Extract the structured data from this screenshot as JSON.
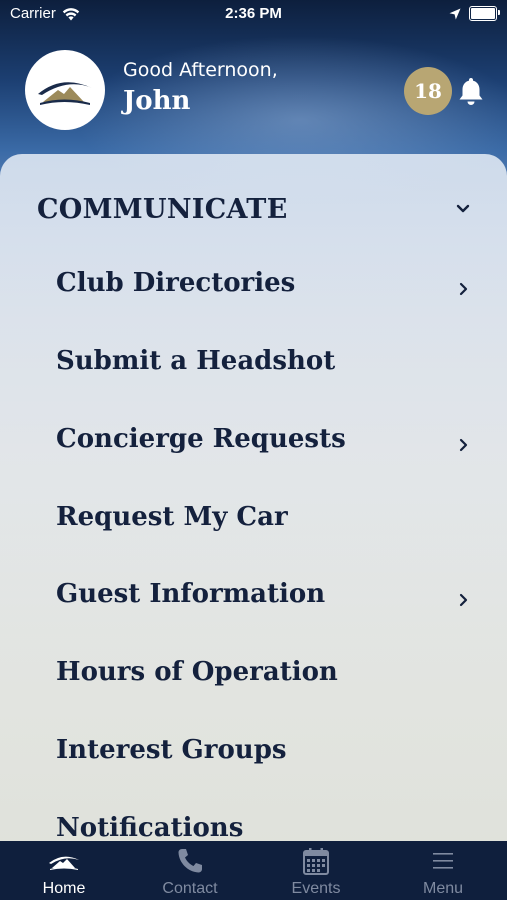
{
  "status_bar": {
    "carrier": "Carrier",
    "time": "2:36 PM"
  },
  "header": {
    "greeting": "Good Afternoon,",
    "user_name": "John",
    "notification_count": "18"
  },
  "menu": {
    "section_title": "COMMUNICATE",
    "items": [
      {
        "label": "Club Directories",
        "has_submenu": true
      },
      {
        "label": "Submit a Headshot",
        "has_submenu": false
      },
      {
        "label": "Concierge Requests",
        "has_submenu": true
      },
      {
        "label": "Request My Car",
        "has_submenu": false
      },
      {
        "label": "Guest Information",
        "has_submenu": true
      },
      {
        "label": "Hours of Operation",
        "has_submenu": false
      },
      {
        "label": "Interest Groups",
        "has_submenu": false
      },
      {
        "label": "Notifications",
        "has_submenu": false
      }
    ]
  },
  "tabbar": {
    "tabs": [
      {
        "label": "Home",
        "icon": "club-logo-icon",
        "active": true
      },
      {
        "label": "Contact",
        "icon": "phone-icon",
        "active": false
      },
      {
        "label": "Events",
        "icon": "calendar-icon",
        "active": false
      },
      {
        "label": "Menu",
        "icon": "hamburger-icon",
        "active": false
      }
    ]
  },
  "colors": {
    "navy_text": "#14213d",
    "badge_gold": "#b8a673",
    "tabbar_bg": "#0f1f3d",
    "tab_inactive": "#7f8aa0"
  }
}
